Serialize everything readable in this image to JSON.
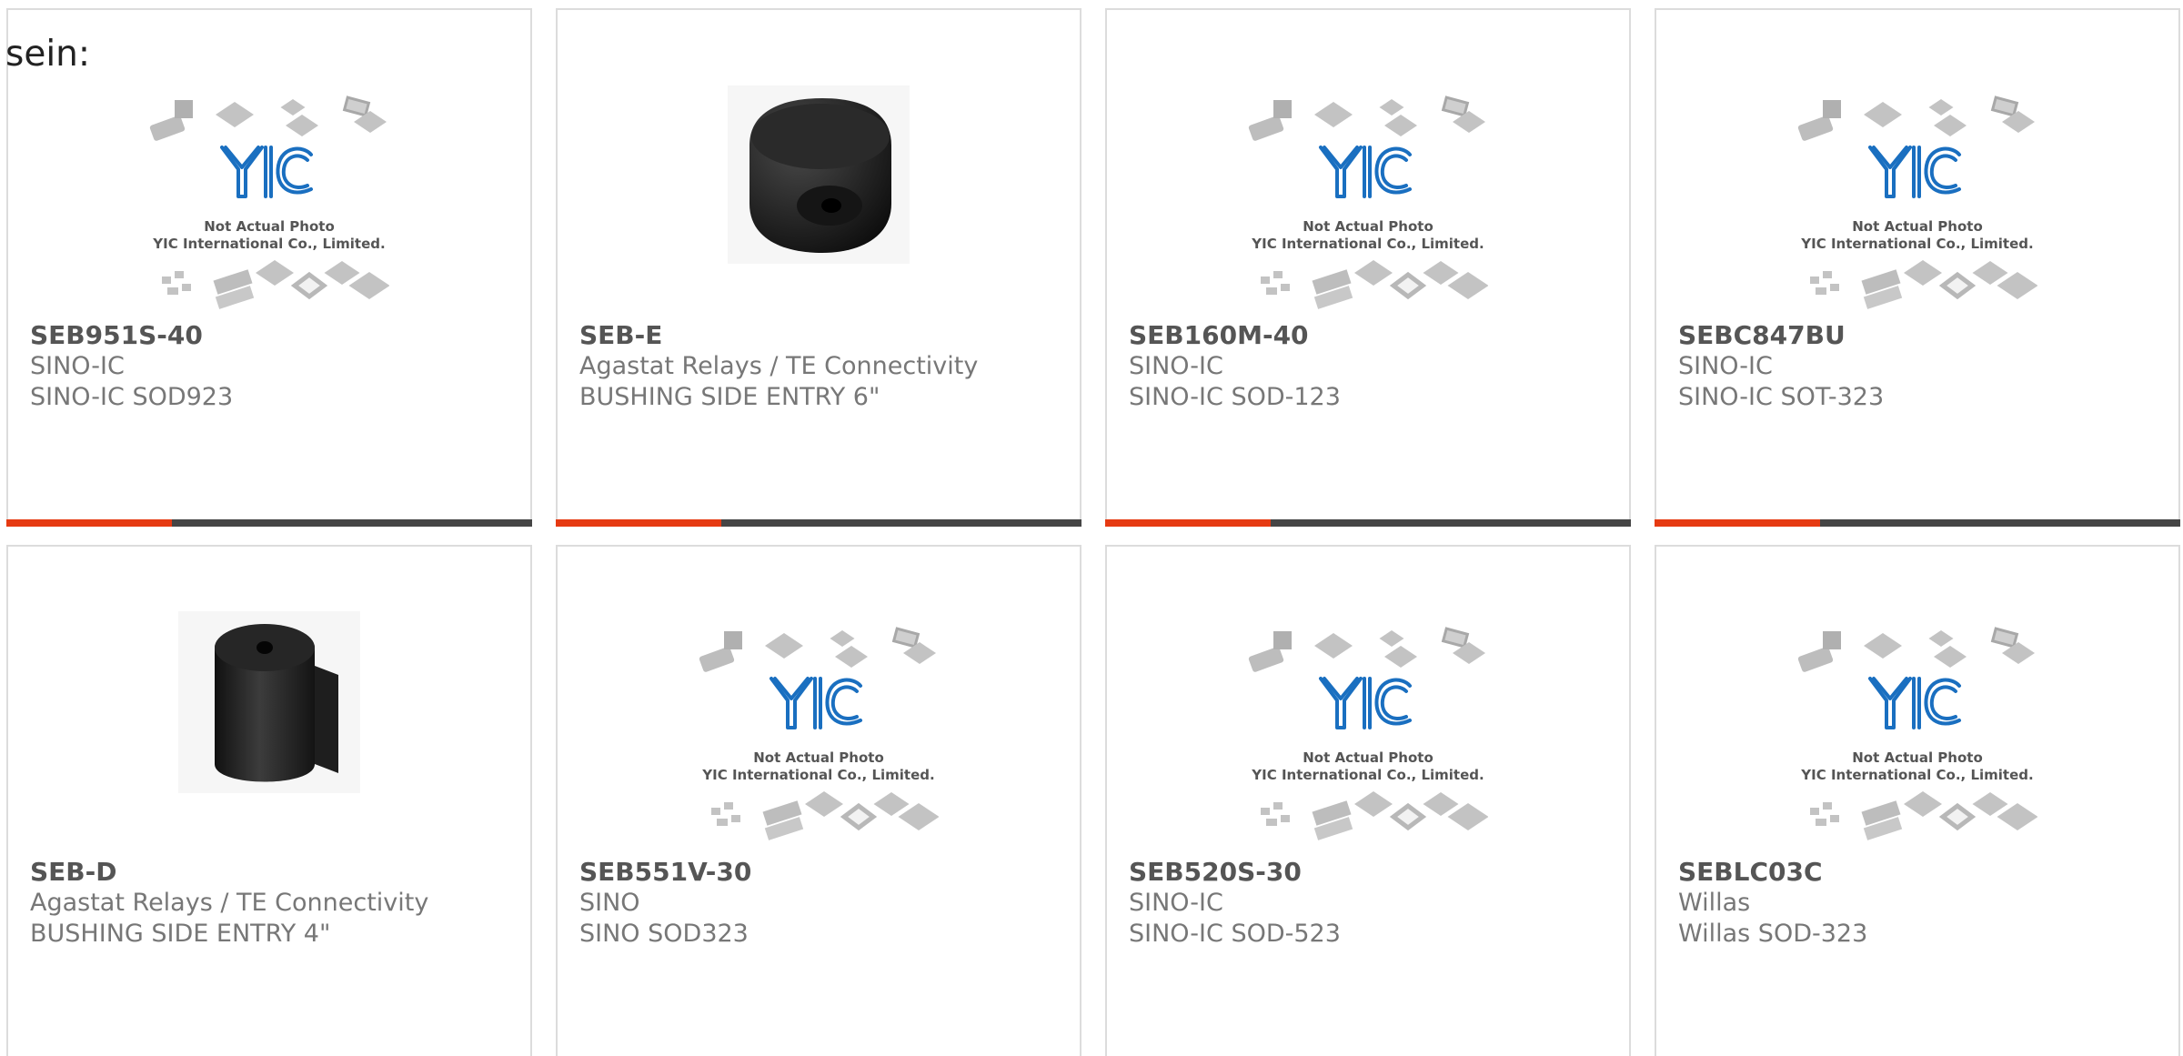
{
  "lead_text": "sein:",
  "placeholder": {
    "line1": "Not Actual Photo",
    "line2": "YIC International Co., Limited.",
    "logo": "YIC"
  },
  "colors": {
    "accent": "#e63a12",
    "bar": "#454545",
    "logo_blue": "#1a6fc0"
  },
  "products": [
    {
      "part": "SEB951S-40",
      "brand": "SINO-IC",
      "desc": "SINO-IC SOD923",
      "image": "placeholder"
    },
    {
      "part": "SEB-E",
      "brand": "Agastat Relays / TE Connectivity",
      "desc": "BUSHING SIDE ENTRY 6\"",
      "image": "rubber-bushing-photo"
    },
    {
      "part": "SEB160M-40",
      "brand": "SINO-IC",
      "desc": "SINO-IC SOD-123",
      "image": "placeholder"
    },
    {
      "part": "SEBC847BU",
      "brand": "SINO-IC",
      "desc": "SINO-IC SOT-323",
      "image": "placeholder"
    },
    {
      "part": "SEB-D",
      "brand": "Agastat Relays / TE Connectivity",
      "desc": "BUSHING SIDE ENTRY 4\"",
      "image": "rubber-strip-photo"
    },
    {
      "part": "SEB551V-30",
      "brand": "SINO",
      "desc": "SINO SOD323",
      "image": "placeholder"
    },
    {
      "part": "SEB520S-30",
      "brand": "SINO-IC",
      "desc": "SINO-IC SOD-523",
      "image": "placeholder"
    },
    {
      "part": "SEBLC03C",
      "brand": "Willas",
      "desc": "Willas SOD-323",
      "image": "placeholder"
    }
  ]
}
